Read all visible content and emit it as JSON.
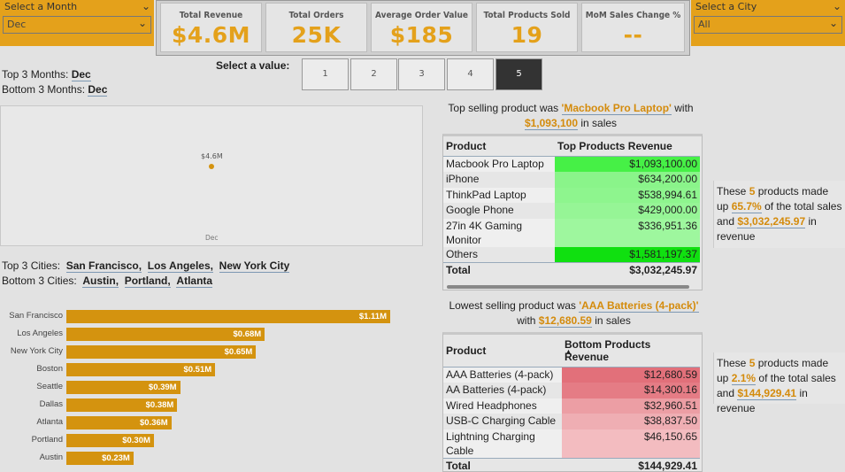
{
  "month_slicer": {
    "label": "Select a Month",
    "value": "Dec"
  },
  "city_slicer": {
    "label": "Select a City",
    "value": "All"
  },
  "kpis": [
    {
      "title": "Total Revenue",
      "value": "$4.6M"
    },
    {
      "title": "Total Orders",
      "value": "25K"
    },
    {
      "title": "Average Order Value",
      "value": "$185"
    },
    {
      "title": "Total Products Sold",
      "value": "19"
    },
    {
      "title": "MoM Sales Change %",
      "value": "--"
    }
  ],
  "months": {
    "top_label": "Top 3 Months:",
    "top_value": "Dec",
    "bottom_label": "Bottom 3 Months:",
    "bottom_value": "Dec"
  },
  "value_picker": {
    "label": "Select a value:",
    "options": [
      "1",
      "2",
      "3",
      "4",
      "5"
    ],
    "selected": "5"
  },
  "line_chart": {
    "point_label": "$4.6M",
    "x_label": "Dec"
  },
  "cities": {
    "top_label": "Top 3 Cities:",
    "top": [
      "San Francisco,",
      "Los Angeles,",
      "New York City"
    ],
    "bottom_label": "Bottom 3 Cities:",
    "bottom": [
      "Austin,",
      "Portland,",
      "Atlanta"
    ]
  },
  "chart_data": {
    "type": "bar",
    "categories": [
      "San Francisco",
      "Los Angeles",
      "New York City",
      "Boston",
      "Seattle",
      "Dallas",
      "Atlanta",
      "Portland",
      "Austin"
    ],
    "values": [
      1.11,
      0.68,
      0.65,
      0.51,
      0.39,
      0.38,
      0.36,
      0.3,
      0.23
    ],
    "labels": [
      "$1.11M",
      "$0.68M",
      "$0.65M",
      "$0.51M",
      "$0.39M",
      "$0.38M",
      "$0.36M",
      "$0.30M",
      "$0.23M"
    ],
    "color": "#d4930f"
  },
  "top_product": {
    "pre": "Top selling product was",
    "name": "'Macbook Pro Laptop'",
    "mid": "with",
    "amount": "$1,093,100",
    "post": "in sales"
  },
  "top_table": {
    "headers": [
      "Product",
      "Top Products Revenue"
    ],
    "rows": [
      {
        "product": "Macbook Pro Laptop",
        "revenue": "$1,093,100.00",
        "color": "#46f046"
      },
      {
        "product": "iPhone",
        "revenue": "$634,200.00",
        "color": "#8af48a"
      },
      {
        "product": "ThinkPad Laptop",
        "revenue": "$538,994.61",
        "color": "#8ef58e"
      },
      {
        "product": "Google Phone",
        "revenue": "$429,000.00",
        "color": "#96f596"
      },
      {
        "product": "27in 4K Gaming Monitor",
        "revenue": "$336,951.36",
        "color": "#9ef79e"
      },
      {
        "product": "Others",
        "revenue": "$1,581,197.37",
        "color": "#10e010"
      }
    ],
    "total_label": "Total",
    "total": "$3,032,245.97"
  },
  "top_summary": {
    "t1": "These",
    "count": "5",
    "t2": "products made up",
    "pct": "65.7%",
    "t3": "of the total sales and",
    "amount": "$3,032,245.97",
    "t4": "in revenue"
  },
  "low_product": {
    "pre": "Lowest selling product was",
    "name": "'AAA Batteries (4-pack)'",
    "mid": "with",
    "amount": "$12,680.59",
    "post": "in sales"
  },
  "bottom_table": {
    "headers": [
      "Product",
      "Bottom Products Revenue"
    ],
    "rows": [
      {
        "product": "AAA Batteries (4-pack)",
        "revenue": "$12,680.59",
        "color": "#e2707a"
      },
      {
        "product": "AA Batteries (4-pack)",
        "revenue": "$14,300.16",
        "color": "#e57c85"
      },
      {
        "product": "Wired Headphones",
        "revenue": "$32,960.51",
        "color": "#ec9ea4"
      },
      {
        "product": "USB-C Charging Cable",
        "revenue": "$38,837.50",
        "color": "#efaeb3"
      },
      {
        "product": "Lightning Charging Cable",
        "revenue": "$46,150.65",
        "color": "#f3bcc0"
      }
    ],
    "total_label": "Total",
    "total": "$144,929.41"
  },
  "bottom_summary": {
    "t1": "These",
    "count": "5",
    "t2": "products made up",
    "pct": "2.1%",
    "t3": "of the total sales and",
    "amount": "$144,929.41",
    "t4": "in revenue"
  }
}
